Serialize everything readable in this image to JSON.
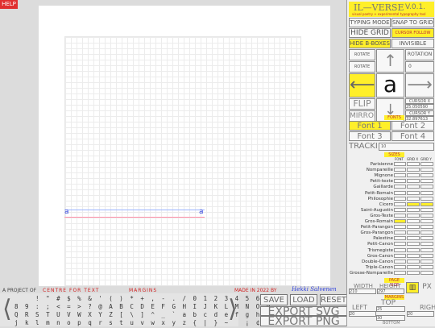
{
  "help": "HELP",
  "canvas": {
    "glyph": "a"
  },
  "footer": {
    "project": "A PROJECT OF",
    "centre": "CENTRE FOR TEXT",
    "margins": "MARGINS",
    "made": "MADE IN 2022 BY",
    "author": "Hekki Salvenen"
  },
  "keyboard": {
    "left": "⟨",
    "right": "⟩",
    "row1": "    ! \" # $ % & ' ( ) * + , - . / 0 1 2 3 4 5 6 7",
    "row2": "8 9 : ; < = > ? @ A B C D E F G H I J K L M N O P",
    "row3": "Q R S T U V W X Y Z [ \\ ] ^ _ ` a b c d e f g h i",
    "row4": "j k l m n o p q r s t u v w x y z { | } ~   ¡ ¢ £"
  },
  "actions": {
    "save": "SAVE",
    "load": "LOAD",
    "reset": "RESET",
    "export_svg": "EXPORT SVG",
    "export_png": "EXPORT PNG"
  },
  "panel": {
    "title": "IL—VERSE",
    "version": "V.0.1.",
    "tagline": "visual poetry + experimental typography tool",
    "typing_mode": "TYPING MODE",
    "snap_grid": "SNAP TO GRID",
    "hide_grid": "HIDE GRID",
    "cursor_follow": "CURSOR FOLLOW",
    "hide_bboxes": "HIDE B-BOXES",
    "invisible_text": "INVISIBLE TEXT",
    "rotate_left": "ROTATE LEFT",
    "rotate_right": "ROTATE RIGHT",
    "rotation_label": "ROTATION",
    "rotation_value": "0",
    "up": "↑",
    "down": "↓",
    "left_arrow": "⟵",
    "right_arrow": "⟶",
    "current_glyph": "a",
    "flip": "FLIP",
    "mirror": "MIRROR",
    "cursor_x_label": "CURSOR X",
    "cursor_x": "25.050590",
    "cursor_y_label": "CURSOR Y",
    "cursor_y": "32.897613",
    "fonts_header": "FONTS",
    "fonts": [
      "Font 1",
      "Font 2",
      "Font 3",
      "Font 4"
    ],
    "tracking_label": "TRACKING",
    "tracking_value": "10",
    "sizes_header": "SIZES",
    "size_cols": [
      "FONT",
      "GRID X",
      "GRID Y"
    ],
    "sizes": [
      "Parisienne",
      "Nompareille",
      "Mignone",
      "Petit-texte",
      "Gaillarde",
      "Petit-Romain",
      "Philosophie",
      "Cicero",
      "Saint-Augustin",
      "Gros-Texte",
      "Gros-Romain",
      "Petit-Parangon",
      "Gros-Parangon",
      "Palestine",
      "Petit-Canon",
      "Trismegiste",
      "Gros-Canon",
      "Double-Canon",
      "Triple-Canon",
      "Grosse-Nompareille"
    ],
    "page_size_header": "PAGE SIZE",
    "width_label": "WIDTH",
    "height_label": "HEIGHT",
    "width": "210",
    "height": "297",
    "unit": "PX",
    "margins_header": "MARGINS",
    "top_label": "TOP",
    "left_label": "LEFT",
    "right_label": "RIGHT",
    "bottom_label": "BOTTOM",
    "margin_top": "25",
    "margin_left": "20",
    "margin_right": "20",
    "margin_bottom": "30"
  }
}
